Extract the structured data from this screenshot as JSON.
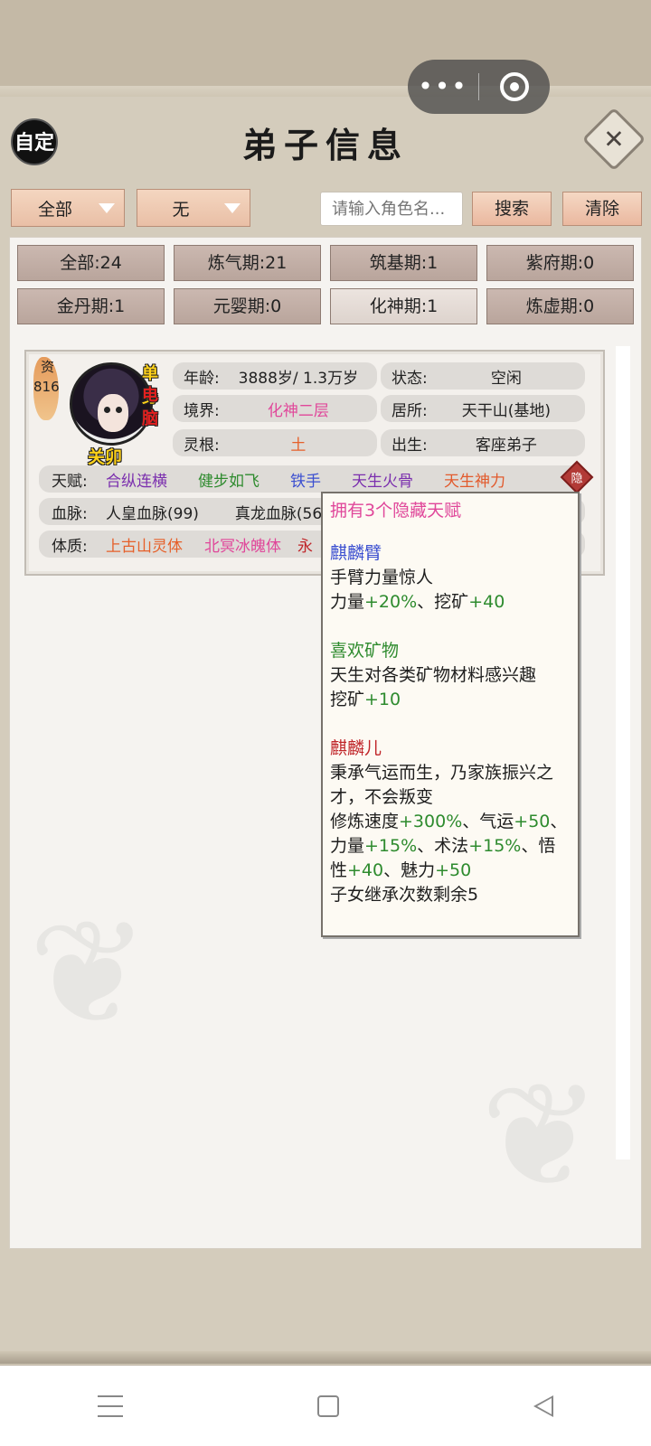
{
  "header": {
    "auto_label": "自定",
    "title": "弟子信息",
    "close_symbol": "✕",
    "capsule_more": "•••"
  },
  "filters": {
    "dropdown1": "全部",
    "dropdown2": "无",
    "search_placeholder": "请输入角色名...",
    "search_btn": "搜索",
    "clear_btn": "清除"
  },
  "realms": [
    {
      "label": "全部:24"
    },
    {
      "label": "炼气期:21"
    },
    {
      "label": "筑基期:1"
    },
    {
      "label": "紫府期:0"
    },
    {
      "label": "金丹期:1"
    },
    {
      "label": "元婴期:0"
    },
    {
      "label": "化神期:1",
      "active": true
    },
    {
      "label": "炼虚期:0"
    }
  ],
  "card": {
    "aptitude_label": "资",
    "aptitude_value": "816",
    "tag_single": "单身",
    "tag_pc": "电脑",
    "name": "关卯",
    "age_label": "年龄:",
    "age_value": "3888岁/ 1.3万岁",
    "status_label": "状态:",
    "status_value": "空闲",
    "realm_label": "境界:",
    "realm_value": "化神二层",
    "residence_label": "居所:",
    "residence_value": "天干山(基地)",
    "root_label": "灵根:",
    "root_value": "土",
    "birth_label": "出生:",
    "birth_value": "客座弟子",
    "talent_label": "天赋:",
    "talents": [
      "合纵连横",
      "健步如飞",
      "铁手",
      "天生火骨",
      "天生神力"
    ],
    "hidden_badge": "隐",
    "bloodline_label": "血脉:",
    "bloodlines": [
      "人皇血脉(99)",
      "真龙血脉(56"
    ],
    "physique_label": "体质:",
    "physiques": [
      "上古山灵体",
      "北冥冰魄体",
      "永"
    ]
  },
  "tooltip": {
    "header": "拥有3个隐藏天赋",
    "t1_name": "麒麟臂",
    "t1_desc": "手臂力量惊人",
    "t1_e1": "力量",
    "t1_e1v": "+20%",
    "t1_sep": "、挖矿",
    "t1_e2v": "+40",
    "t2_name": "喜欢矿物",
    "t2_desc": "天生对各类矿物材料感兴趣",
    "t2_e1": "挖矿",
    "t2_e1v": "+10",
    "t3_name": "麒麟儿",
    "t3_desc": "秉承气运而生，乃家族振兴之才，不会叛变",
    "t3_a": "修炼速度",
    "t3_av": "+300%",
    "t3_b": "、气运",
    "t3_bv": "+50",
    "t3_c": "、力量",
    "t3_cv": "+15%",
    "t3_d": "、术法",
    "t3_dv": "+15%",
    "t3_e": "、悟性",
    "t3_ev": "+40",
    "t3_f": "、魅力",
    "t3_fv": "+50",
    "t3_inherit": "子女继承次数剩余5"
  },
  "colors": {
    "accent_pink": "#e0479a",
    "bonus_green": "#2e8b2e",
    "button_peach": "#eab89f"
  }
}
